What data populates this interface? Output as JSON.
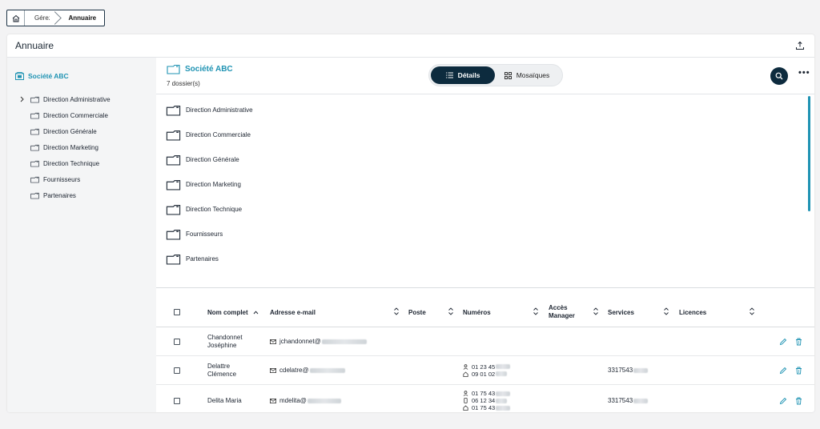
{
  "breadcrumb": {
    "items": [
      {
        "label": "Gérer"
      },
      {
        "label": "Annuaire"
      }
    ]
  },
  "page": {
    "title": "Annuaire"
  },
  "tree": {
    "root": "Société ABC",
    "items": [
      {
        "label": "Direction Administrative"
      },
      {
        "label": "Direction Commerciale"
      },
      {
        "label": "Direction Générale"
      },
      {
        "label": "Direction Marketing"
      },
      {
        "label": "Direction Technique"
      },
      {
        "label": "Fournisseurs"
      },
      {
        "label": "Partenaires"
      }
    ]
  },
  "content": {
    "title": "Société ABC",
    "count": "7 dossier(s)",
    "views": {
      "details": "Détails",
      "mosaics": "Mosaïques"
    },
    "folders": [
      {
        "label": "Direction Administrative"
      },
      {
        "label": "Direction Commerciale"
      },
      {
        "label": "Direction Générale"
      },
      {
        "label": "Direction Marketing"
      },
      {
        "label": "Direction Technique"
      },
      {
        "label": "Fournisseurs"
      },
      {
        "label": "Partenaires"
      }
    ]
  },
  "table": {
    "headers": {
      "name": "Nom complet",
      "email": "Adresse e-mail",
      "post": "Poste",
      "numbers": "Numéros",
      "manager_line1": "Accès",
      "manager_line2": "Manager",
      "services": "Services",
      "licences": "Licences"
    },
    "rows": [
      {
        "name_line1": "Chandonnet",
        "name_line2": "Joséphine",
        "email": "jchandonnet@",
        "numbers": [],
        "services": ""
      },
      {
        "name_line1": "Delattre",
        "name_line2": "Clémence",
        "email": "cdelatre@",
        "numbers": [
          "01 23 45",
          "09 01 02"
        ],
        "services": "3317543"
      },
      {
        "name_line1": "Delita Maria",
        "name_line2": "",
        "email": "mdelita@",
        "numbers": [
          "01 75 43",
          "06 12 34",
          "01 75 43"
        ],
        "services": "3317543"
      }
    ]
  },
  "colors": {
    "accent": "#1f93b3",
    "dark": "#0d2b3e"
  }
}
